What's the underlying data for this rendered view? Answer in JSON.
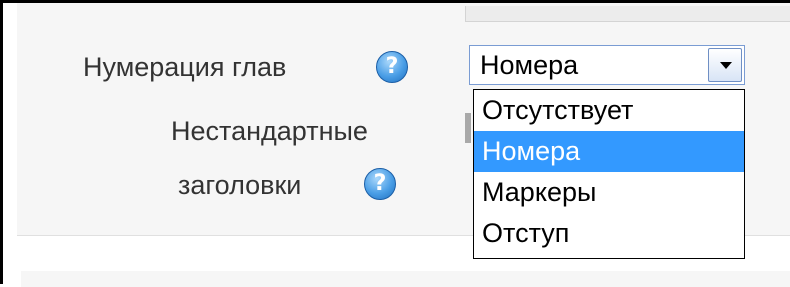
{
  "form": {
    "chapter_numbering_label": "Нумерация глав",
    "custom_titles_label_line1": "Нестандартные",
    "custom_titles_label_line2": "заголовки",
    "help_icon_glyph": "?"
  },
  "chapter_numbering_select": {
    "selected_value": "Номера",
    "options": [
      "Отсутствует",
      "Номера",
      "Маркеры",
      "Отступ"
    ],
    "highlighted_index": 1
  },
  "colors": {
    "highlight": "#3399ff",
    "help_icon": "#4a9ee6"
  },
  "icons": {
    "help": "help-icon",
    "dropdown_arrow": "chevron-down-icon"
  }
}
